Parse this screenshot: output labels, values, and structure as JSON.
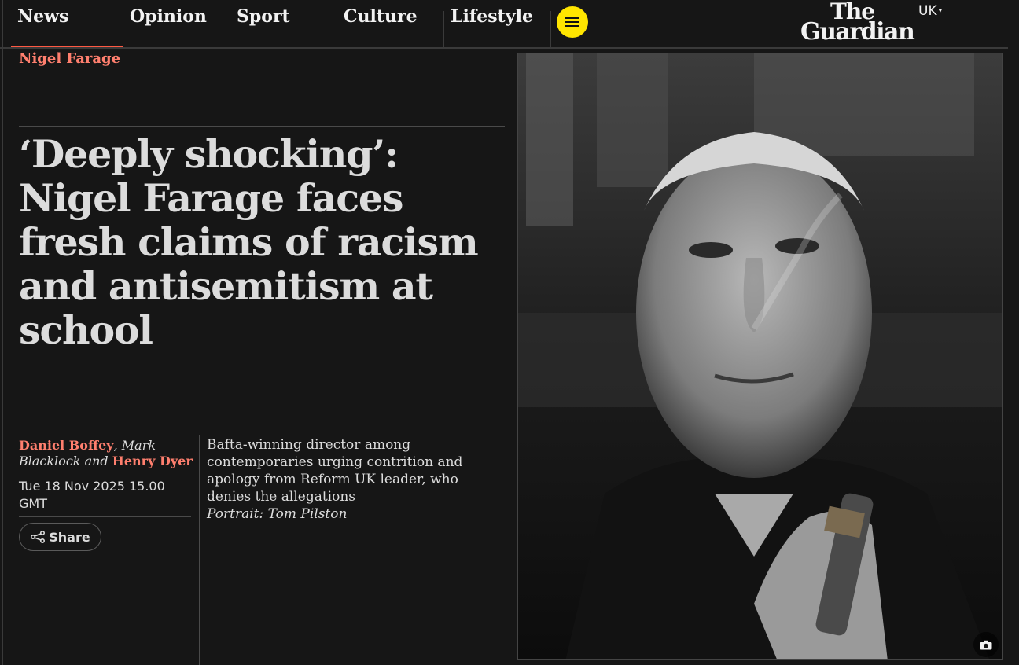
{
  "nav": {
    "items": [
      {
        "label": "News",
        "active": true
      },
      {
        "label": "Opinion"
      },
      {
        "label": "Sport"
      },
      {
        "label": "Culture"
      },
      {
        "label": "Lifestyle"
      }
    ],
    "menu_icon": "hamburger-menu-icon",
    "logo": {
      "line1": "The",
      "line2": "Guardian"
    },
    "edition": "UK"
  },
  "article": {
    "kicker": "Nigel Farage",
    "headline": "‘Deeply shocking’: Nigel Farage faces fresh claims of racism and antisemitism at school",
    "byline": {
      "author1": "Daniel Boffey",
      "sep1": ", ",
      "author2": "Mark Blacklock",
      "sep2": " and ",
      "author3": "Henry Dyer"
    },
    "date": "Tue 18 Nov 2025 15.00 GMT",
    "share_label": "Share",
    "standfirst": "Bafta-winning director among contemporaries urging contrition and apology from Reform UK leader, who denies the allegations",
    "photo_credit": "Portrait: Tom Pilston"
  },
  "colors": {
    "background": "#161616",
    "accent": "#ff7f6e",
    "menu_button": "#ffe500"
  }
}
